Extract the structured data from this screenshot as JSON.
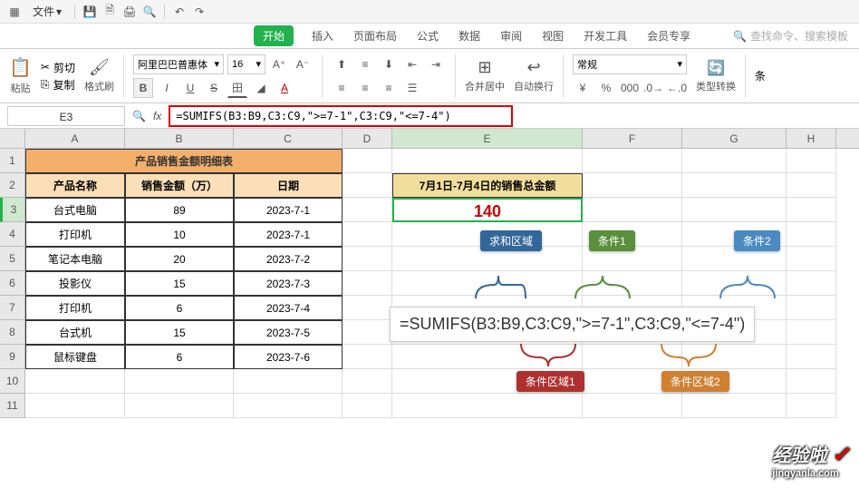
{
  "menubar": {
    "file": "文件"
  },
  "tabs": {
    "start": "开始",
    "insert": "插入",
    "layout": "页面布局",
    "formula": "公式",
    "data": "数据",
    "review": "审阅",
    "view": "视图",
    "dev": "开发工具",
    "member": "会员专享",
    "search_ph": "查找命令、搜索模板"
  },
  "ribbon": {
    "paste": "粘贴",
    "cut": "剪切",
    "copy": "复制",
    "format_painter": "格式刷",
    "font_name": "阿里巴巴普惠体",
    "font_size": "16",
    "merge": "合并居中",
    "wrap": "自动换行",
    "numfmt": "常规",
    "type_conv": "类型转换",
    "cond": "条"
  },
  "cell_ref": "E3",
  "formula_bar": "=SUMIFS(B3:B9,C3:C9,\">=7-1\",C3:C9,\"<=7-4\")",
  "cols": [
    "A",
    "B",
    "C",
    "D",
    "E",
    "F",
    "G",
    "H"
  ],
  "table": {
    "title": "产品销售金额明细表",
    "h1": "产品名称",
    "h2": "销售金额（万）",
    "h3": "日期",
    "rows": [
      {
        "a": "台式电脑",
        "b": "89",
        "c": "2023-7-1"
      },
      {
        "a": "打印机",
        "b": "10",
        "c": "2023-7-1"
      },
      {
        "a": "笔记本电脑",
        "b": "20",
        "c": "2023-7-2"
      },
      {
        "a": "投影仪",
        "b": "15",
        "c": "2023-7-3"
      },
      {
        "a": "打印机",
        "b": "6",
        "c": "2023-7-4"
      },
      {
        "a": "台式机",
        "b": "15",
        "c": "2023-7-5"
      },
      {
        "a": "鼠标键盘",
        "b": "6",
        "c": "2023-7-6"
      }
    ]
  },
  "result": {
    "title": "7月1日-7月4日的销售总金额",
    "value": "140"
  },
  "annot": {
    "sum_range": "求和区域",
    "cond1": "条件1",
    "cond2": "条件2",
    "crit_range1": "条件区域1",
    "crit_range2": "条件区域2",
    "formula": "=SUMIFS(B3:B9,C3:C9,\">=7-1\",C3:C9,\"<=7-4\")"
  },
  "watermark": {
    "main": "经验啦",
    "sub": "jingyanla.com"
  }
}
